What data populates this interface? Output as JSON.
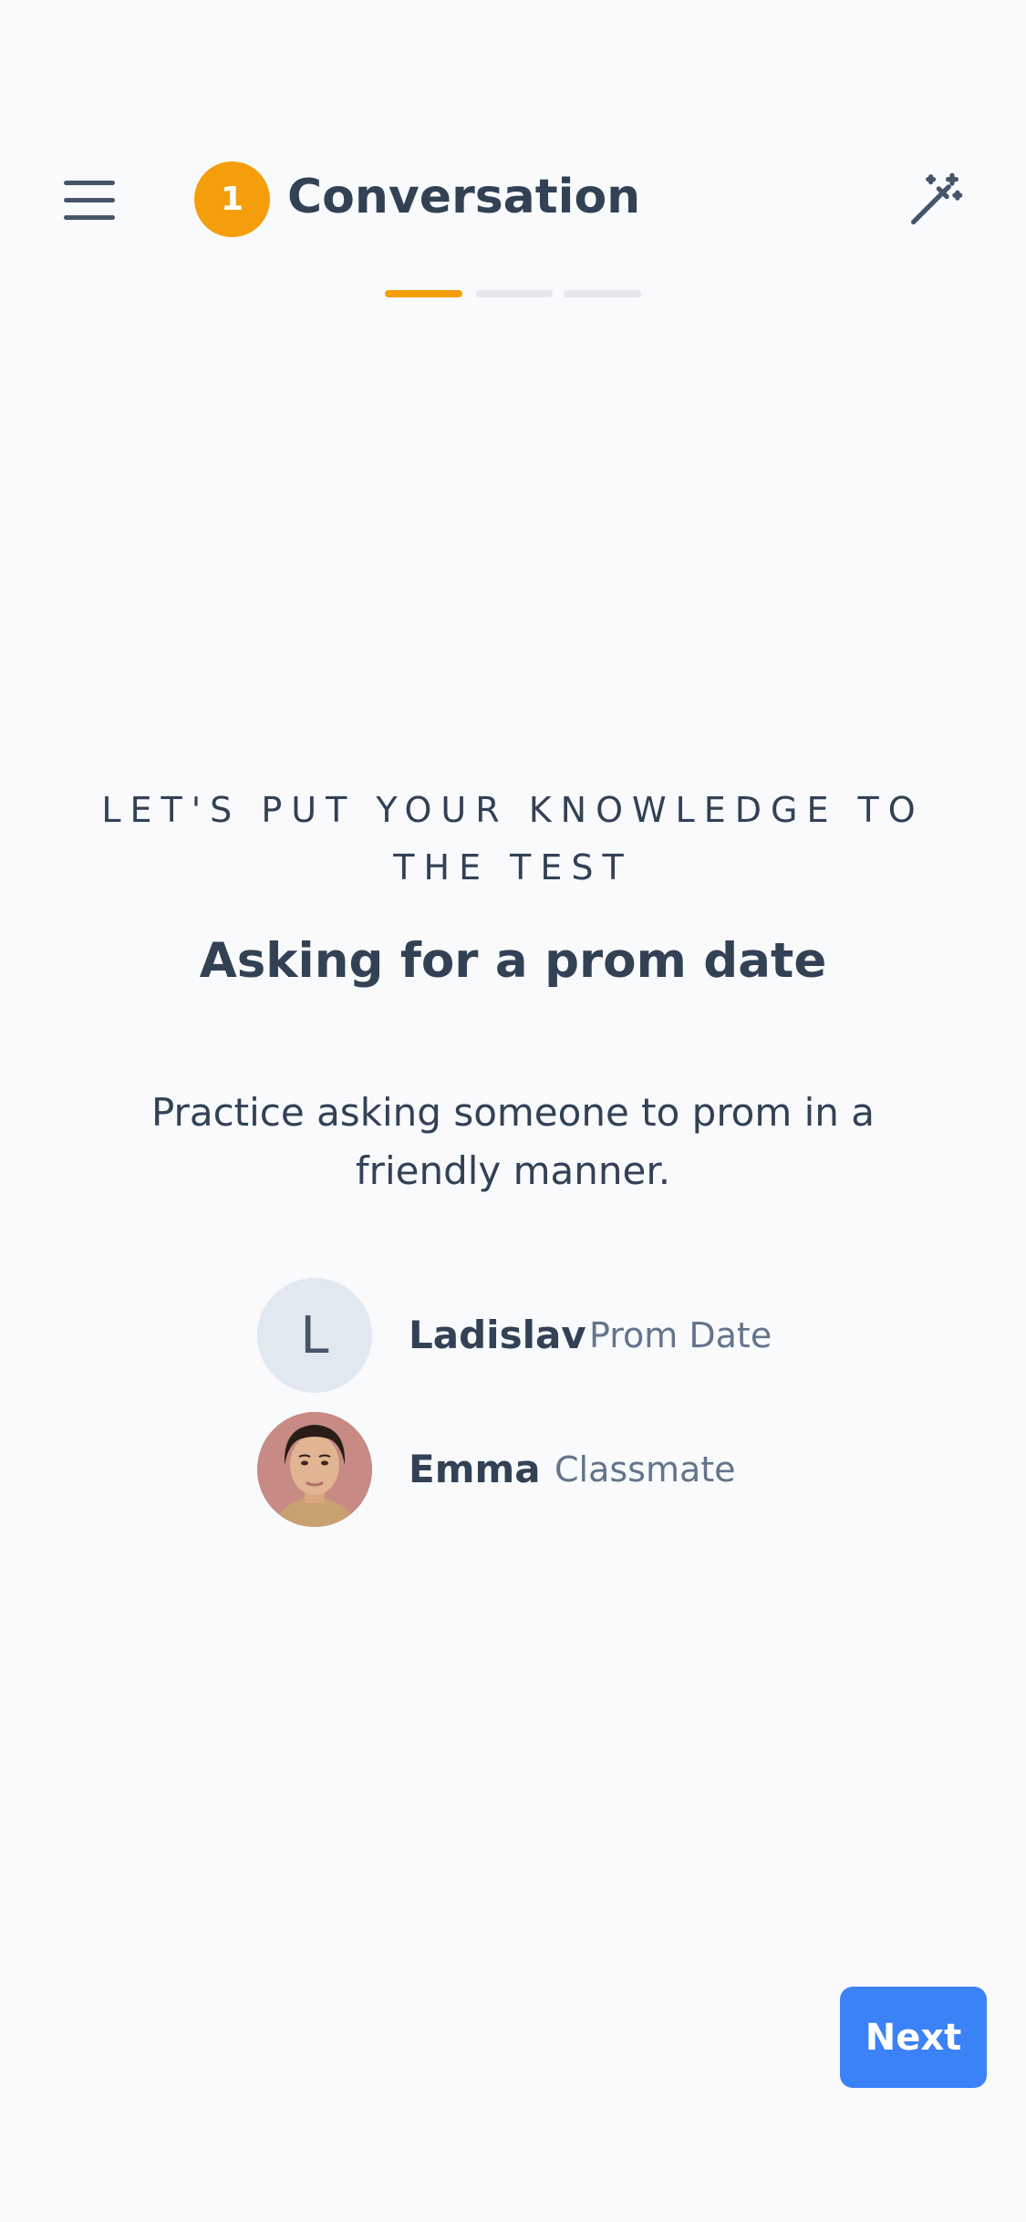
{
  "header": {
    "step_number": "1",
    "title": "Conversation",
    "menu_icon": "hamburger-menu-icon",
    "magic_icon": "magic-wand-sparkles-icon",
    "progress": {
      "current": 1,
      "total": 3
    }
  },
  "intro": {
    "eyebrow": "LET'S PUT YOUR KNOWLEDGE TO THE TEST",
    "title": "Asking for a prom date",
    "description": "Practice asking someone to prom in a friendly manner."
  },
  "participants": [
    {
      "initial": "L",
      "name": "Ladislav",
      "role": "Prom Date"
    },
    {
      "name": "Emma",
      "role": "Classmate"
    }
  ],
  "actions": {
    "next_label": "Next"
  },
  "colors": {
    "accent": "#f59e0b",
    "primary_button": "#3b82f6",
    "text": "#334155",
    "muted_text": "#64748b",
    "background": "#f8fafc"
  }
}
